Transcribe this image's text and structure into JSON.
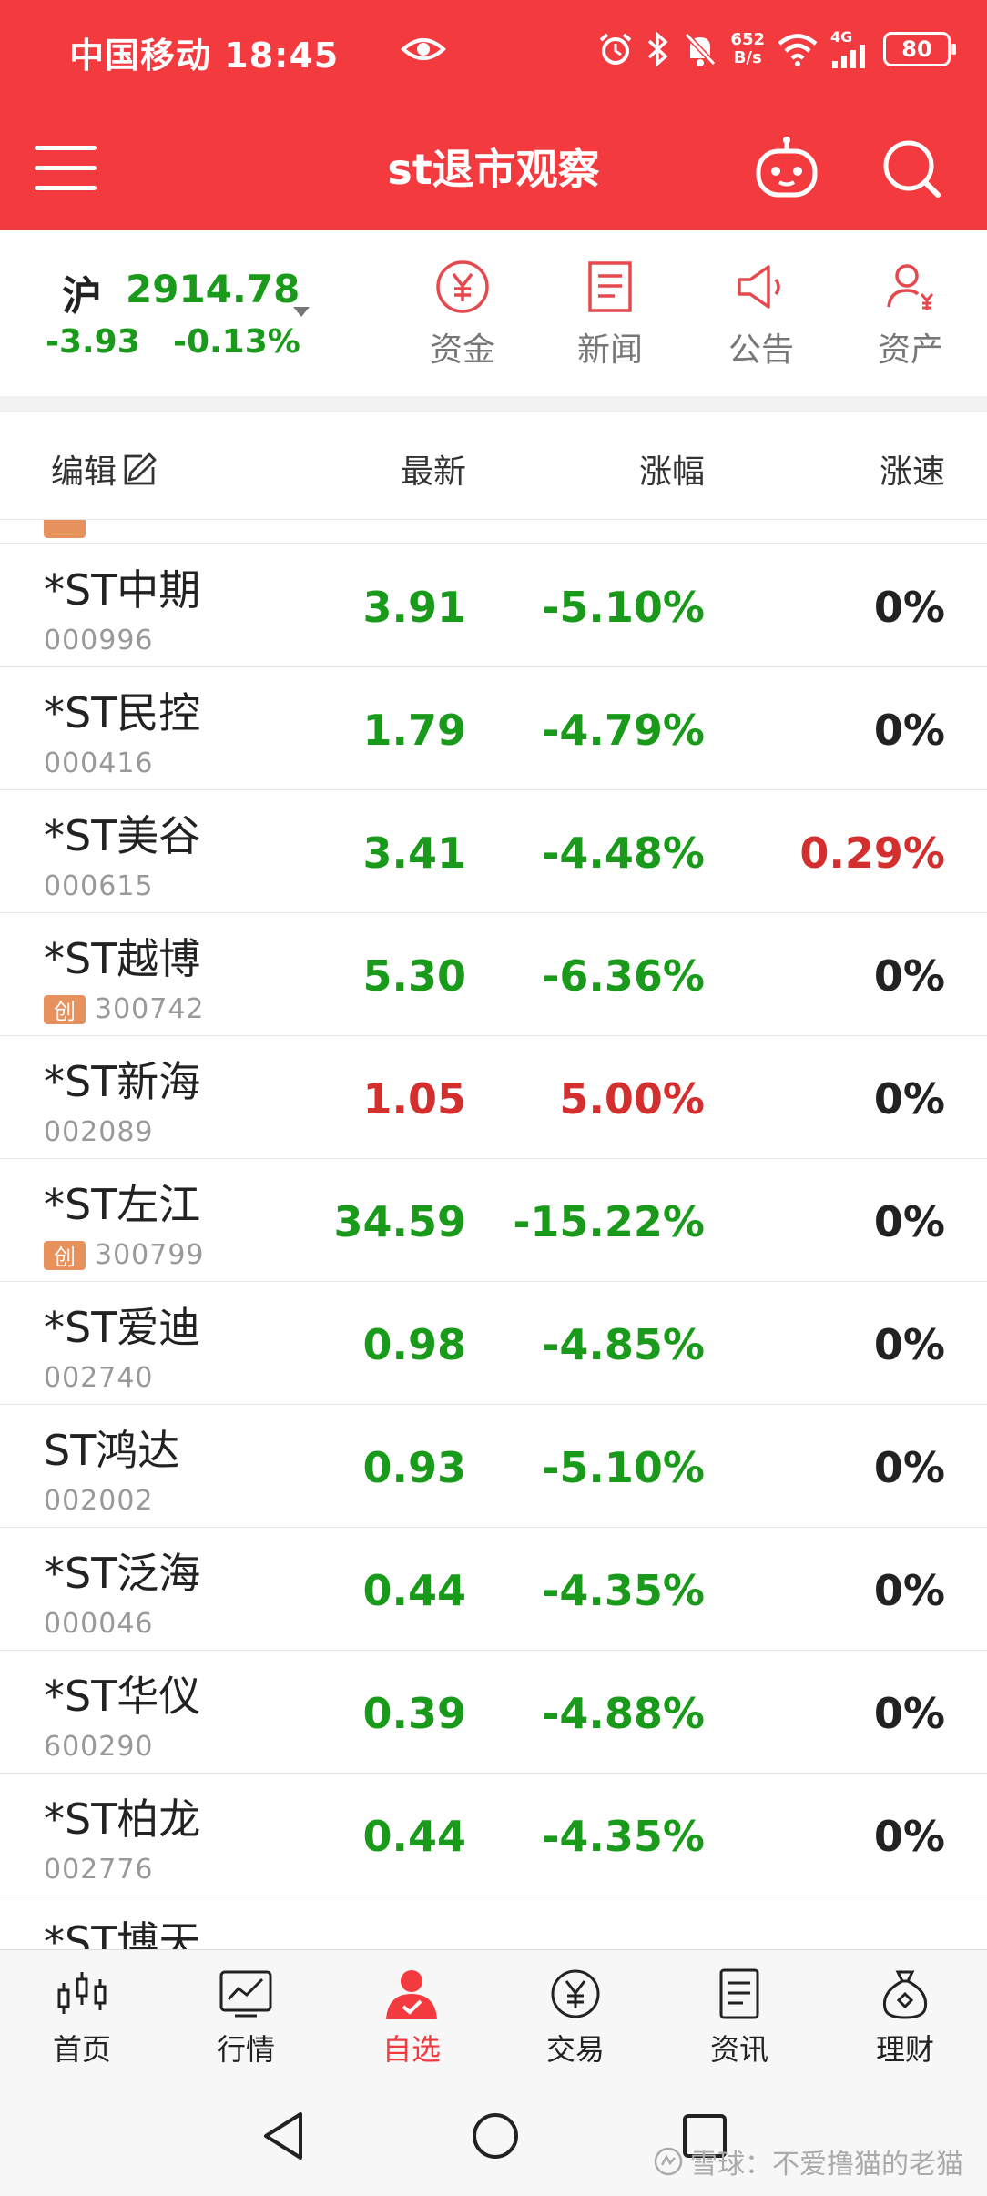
{
  "status_bar": {
    "carrier": "中国移动",
    "time": "18:45",
    "net_speed_value": "652",
    "net_speed_unit": "B/s",
    "signal_label": "4G",
    "battery": "80"
  },
  "title_bar": {
    "title": "st退市观察"
  },
  "index": {
    "name": "沪",
    "value": "2914.78",
    "change": "-3.93",
    "change_pct": "-0.13%"
  },
  "quick_links": [
    {
      "label": "资金",
      "icon": "yuan-circle-icon"
    },
    {
      "label": "新闻",
      "icon": "news-icon"
    },
    {
      "label": "公告",
      "icon": "megaphone-icon"
    },
    {
      "label": "资产",
      "icon": "user-assets-icon"
    }
  ],
  "list_header": {
    "edit": "编辑",
    "latest": "最新",
    "change": "涨幅",
    "speed": "涨速"
  },
  "stocks": [
    {
      "name": "*ST中期",
      "code": "000996",
      "tag": "",
      "latest": "3.91",
      "change": "-5.10%",
      "speed": "0%",
      "latest_color": "green",
      "change_color": "green",
      "speed_color": "black"
    },
    {
      "name": "*ST民控",
      "code": "000416",
      "tag": "",
      "latest": "1.79",
      "change": "-4.79%",
      "speed": "0%",
      "latest_color": "green",
      "change_color": "green",
      "speed_color": "black"
    },
    {
      "name": "*ST美谷",
      "code": "000615",
      "tag": "",
      "latest": "3.41",
      "change": "-4.48%",
      "speed": "0.29%",
      "latest_color": "green",
      "change_color": "green",
      "speed_color": "red"
    },
    {
      "name": "*ST越博",
      "code": "300742",
      "tag": "创",
      "latest": "5.30",
      "change": "-6.36%",
      "speed": "0%",
      "latest_color": "green",
      "change_color": "green",
      "speed_color": "black"
    },
    {
      "name": "*ST新海",
      "code": "002089",
      "tag": "",
      "latest": "1.05",
      "change": "5.00%",
      "speed": "0%",
      "latest_color": "red",
      "change_color": "red",
      "speed_color": "black"
    },
    {
      "name": "*ST左江",
      "code": "300799",
      "tag": "创",
      "latest": "34.59",
      "change": "-15.22%",
      "speed": "0%",
      "latest_color": "green",
      "change_color": "green",
      "speed_color": "black"
    },
    {
      "name": "*ST爱迪",
      "code": "002740",
      "tag": "",
      "latest": "0.98",
      "change": "-4.85%",
      "speed": "0%",
      "latest_color": "green",
      "change_color": "green",
      "speed_color": "black"
    },
    {
      "name": "ST鸿达",
      "code": "002002",
      "tag": "",
      "latest": "0.93",
      "change": "-5.10%",
      "speed": "0%",
      "latest_color": "green",
      "change_color": "green",
      "speed_color": "black"
    },
    {
      "name": "*ST泛海",
      "code": "000046",
      "tag": "",
      "latest": "0.44",
      "change": "-4.35%",
      "speed": "0%",
      "latest_color": "green",
      "change_color": "green",
      "speed_color": "black"
    },
    {
      "name": "*ST华仪",
      "code": "600290",
      "tag": "",
      "latest": "0.39",
      "change": "-4.88%",
      "speed": "0%",
      "latest_color": "green",
      "change_color": "green",
      "speed_color": "black"
    },
    {
      "name": "*ST柏龙",
      "code": "002776",
      "tag": "",
      "latest": "0.44",
      "change": "-4.35%",
      "speed": "0%",
      "latest_color": "green",
      "change_color": "green",
      "speed_color": "black"
    },
    {
      "name": "*ST博天",
      "code": "",
      "tag": "",
      "latest": "",
      "change": "",
      "speed": "",
      "latest_color": "green",
      "change_color": "green",
      "speed_color": "black"
    }
  ],
  "tabs": [
    {
      "label": "首页",
      "icon": "candlestick-icon",
      "active": false
    },
    {
      "label": "行情",
      "icon": "line-chart-icon",
      "active": false
    },
    {
      "label": "自选",
      "icon": "user-check-icon",
      "active": true
    },
    {
      "label": "交易",
      "icon": "yuan-circle-icon",
      "active": false
    },
    {
      "label": "资讯",
      "icon": "document-icon",
      "active": false
    },
    {
      "label": "理财",
      "icon": "money-bag-icon",
      "active": false
    }
  ],
  "watermark": "雪球：不爱撸猫的老猫",
  "colors": {
    "brand_red": "#f23a3f",
    "up_red": "#d32f2f",
    "down_green": "#1a9a1a",
    "tag_orange": "#e7915c"
  }
}
